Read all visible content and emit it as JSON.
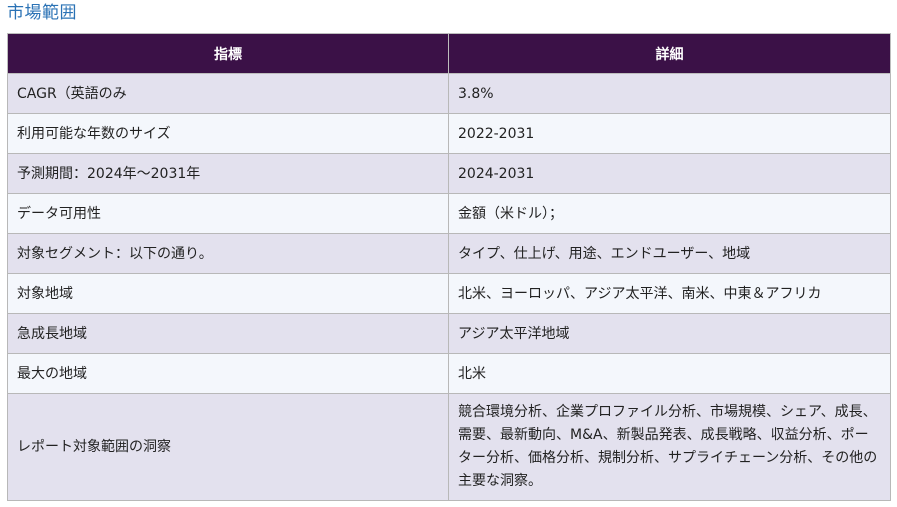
{
  "section_title": "市場範囲",
  "table": {
    "headers": [
      "指標",
      "詳細"
    ],
    "rows": [
      {
        "metric": "CAGR（英語のみ",
        "detail": "3.8%"
      },
      {
        "metric": "利用可能な年数のサイズ",
        "detail": "2022-2031"
      },
      {
        "metric": "予測期間：2024年～2031年",
        "detail": "2024-2031"
      },
      {
        "metric": "データ可用性",
        "detail": "金額（米ドル）；"
      },
      {
        "metric": "対象セグメント：以下の通り。",
        "detail": "タイプ、仕上げ、用途、エンドユーザー、地域"
      },
      {
        "metric": "対象地域",
        "detail": "北米、ヨーロッパ、アジア太平洋、南米、中東＆アフリカ"
      },
      {
        "metric": "急成長地域",
        "detail": "アジア太平洋地域"
      },
      {
        "metric": "最大の地域",
        "detail": "北米"
      },
      {
        "metric": "レポート対象範囲の洞察",
        "detail": "競合環境分析、企業プロファイル分析、市場規模、シェア、成長、需要、最新動向、M&A、新製品発表、成長戦略、収益分析、ポーター分析、価格分析、規制分析、サプライチェーン分析、その他の主要な洞察。"
      }
    ]
  }
}
